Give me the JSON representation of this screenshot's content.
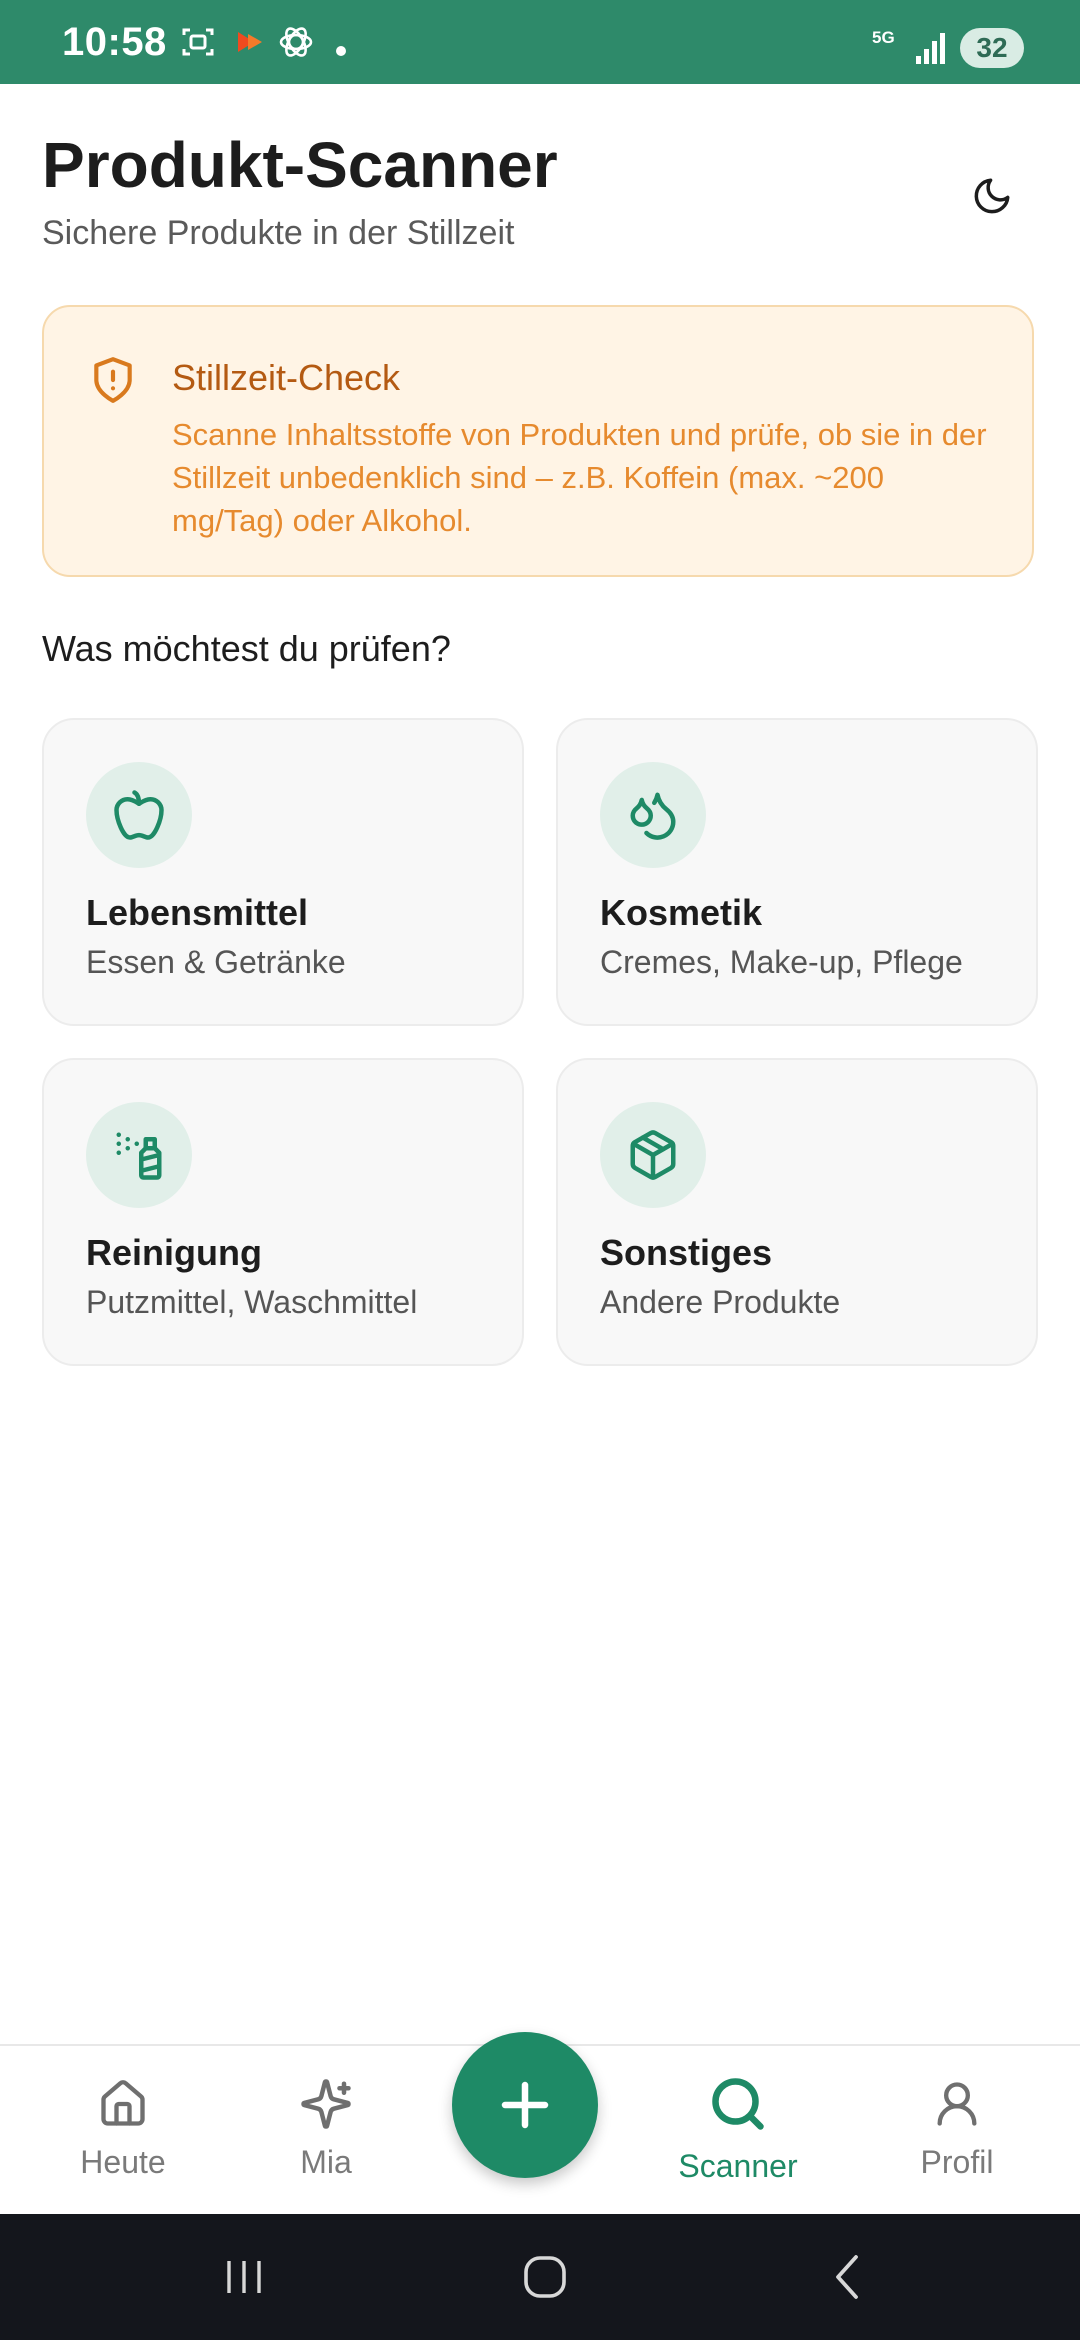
{
  "status_bar": {
    "time": "10:58",
    "network": "5G",
    "battery": "32"
  },
  "header": {
    "title": "Produkt-Scanner",
    "subtitle": "Sichere Produkte in der Stillzeit"
  },
  "info_card": {
    "title": "Stillzeit-Check",
    "text": "Scanne Inhaltsstoffe von Produkten und prüfe, ob sie in der Stillzeit unbedenklich sind – z.B. Koffein (max. ~200 mg/Tag) oder Alkohol."
  },
  "section_heading": "Was möchtest du prüfen?",
  "categories": [
    {
      "title": "Lebensmittel",
      "subtitle": "Essen & Getränke",
      "icon": "apple-icon"
    },
    {
      "title": "Kosmetik",
      "subtitle": "Cremes, Make-up, Pflege",
      "icon": "droplets-icon"
    },
    {
      "title": "Reinigung",
      "subtitle": "Putzmittel, Waschmittel",
      "icon": "spray-bottle-icon"
    },
    {
      "title": "Sonstiges",
      "subtitle": "Andere Produkte",
      "icon": "package-icon"
    }
  ],
  "nav": {
    "items": [
      {
        "label": "Heute",
        "icon": "home-icon",
        "active": false
      },
      {
        "label": "Mia",
        "icon": "sparkles-icon",
        "active": false
      },
      {
        "label": "Scanner",
        "icon": "search-icon",
        "active": true
      },
      {
        "label": "Profil",
        "icon": "user-icon",
        "active": false
      }
    ],
    "fab_icon": "plus-icon"
  },
  "colors": {
    "status_bar": "#2e8a6a",
    "primary": "#1e8a66",
    "info_bg": "#fff4e5",
    "info_title": "#b45a12",
    "info_text": "#e68a2e",
    "icon_circle": "#e1efe9"
  }
}
